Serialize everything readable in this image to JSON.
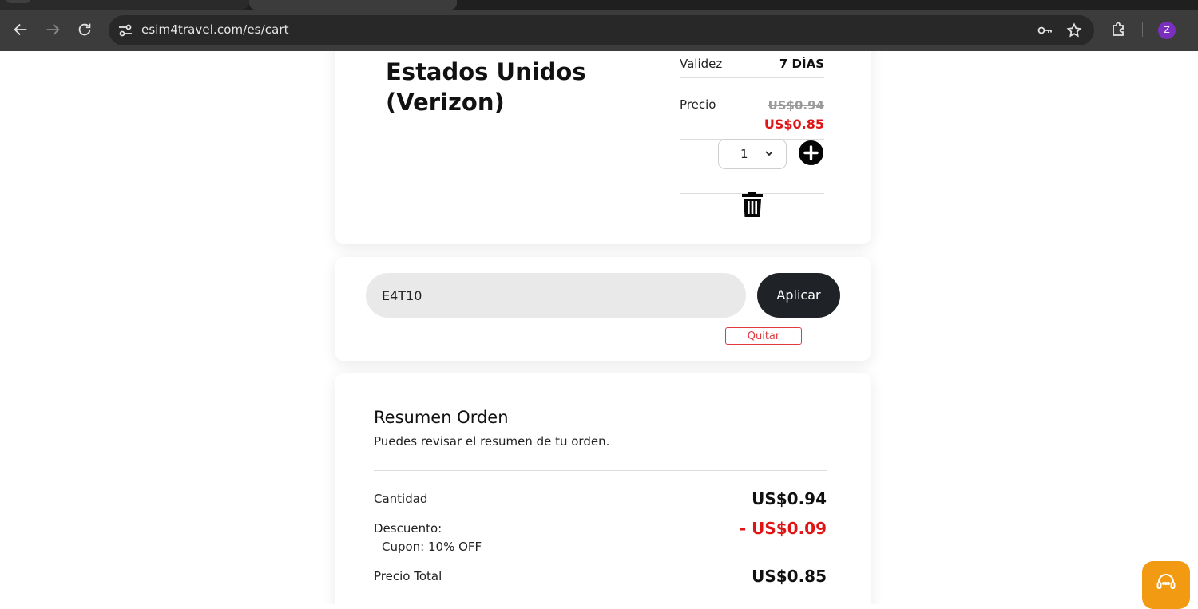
{
  "browser": {
    "url": "esim4travel.com/es/cart",
    "avatar_letter": "Z"
  },
  "product": {
    "name": "Estados Unidos (Verizon)",
    "validity_label": "Validez",
    "validity_value": "7 DÍAS",
    "price_label": "Precio",
    "old_price": "US$0.94",
    "new_price": "US$0.85",
    "quantity": "1"
  },
  "coupon": {
    "code": "E4T10",
    "apply_label": "Aplicar",
    "remove_label": "Quitar"
  },
  "summary": {
    "title": "Resumen Orden",
    "subtitle": "Puedes revisar el resumen de tu orden.",
    "quantity_label": "Cantidad",
    "quantity_value": "US$0.94",
    "discount_label": "Descuento:",
    "coupon_note": "Cupon: 10% OFF",
    "discount_value": "- US$0.09",
    "total_label": "Precio Total",
    "total_value": "US$0.85"
  },
  "colors": {
    "accent_red": "#e01414",
    "chat_orange": "#f29a11",
    "apply_dark": "#1f2327"
  }
}
